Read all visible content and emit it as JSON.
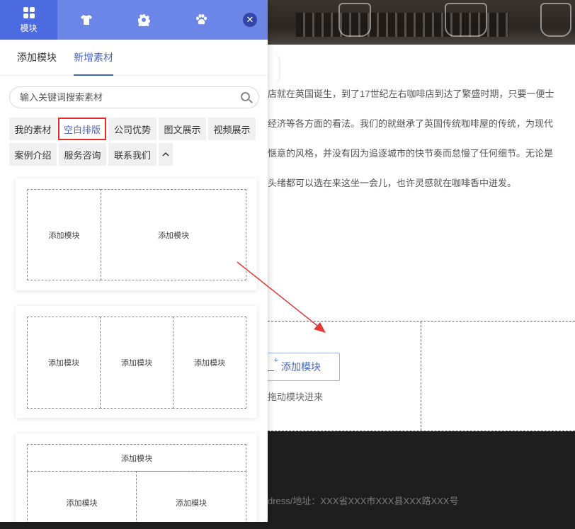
{
  "panel": {
    "top_tabs": [
      {
        "name": "grid-icon",
        "label": "模块"
      },
      {
        "name": "shirt-icon",
        "label": ""
      },
      {
        "name": "gear-icon",
        "label": ""
      },
      {
        "name": "paw-icon",
        "label": ""
      }
    ],
    "close_icon": "close-icon",
    "subtabs": [
      "添加模块",
      "新增素材"
    ],
    "active_subtab": "新增素材",
    "search": {
      "placeholder": "输入关键词搜索素材",
      "icon": "search-icon"
    },
    "tags": [
      "我的素材",
      "空白排版",
      "公司优势",
      "图文展示",
      "视频展示",
      "案例介绍",
      "服务咨询",
      "联系我们"
    ],
    "selected_tag": "空白排版",
    "collapse_icon": "chevron-up-icon",
    "cards": [
      {
        "cells": [
          "添加模块",
          "添加模块"
        ]
      },
      {
        "cells": [
          "添加模块",
          "添加模块",
          "添加模块"
        ]
      },
      {
        "cells": [
          "添加模块",
          "添加模块",
          "添加模块"
        ]
      }
    ]
  },
  "page": {
    "paragraphs": [
      "店就在英国诞生，到了17世纪左右咖啡店到达了繁盛时期，只要一便士",
      "经济等各方面的看法。我们的就继承了英国传统咖啡屋的传统，为现代",
      "惬意的风格，并没有因为追逐城市的快节奏而怠慢了任何细节。无论是",
      "头绪都可以选在来这坐一会儿，也许灵感就在咖啡香中迸发。"
    ],
    "add_module_button": "添加模块",
    "drag_hint": "拖动模块进来",
    "footer_address": "dress/地址：XXX省XXX市XXX县XXX路XXX号"
  },
  "colors": {
    "accent": "#4a67c8",
    "topbar": "#6c86e8",
    "highlight_border": "#e52a2a",
    "arrow": "#e53935"
  }
}
